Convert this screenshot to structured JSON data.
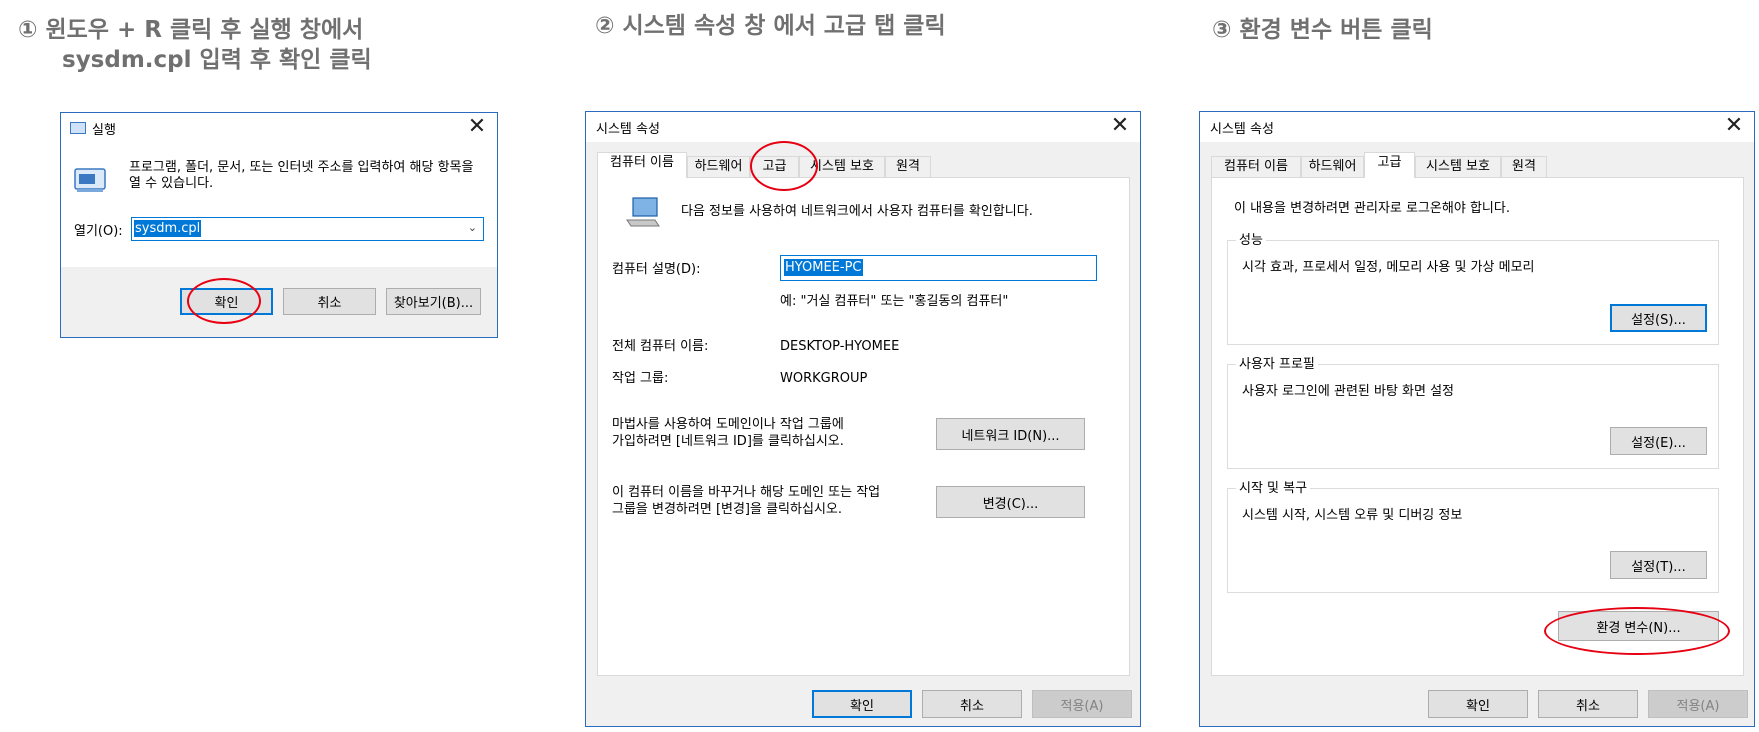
{
  "captions": {
    "step1_line1": "① 윈도우 +  R 클릭 후 실행 창에서",
    "step1_line2": "sysdm.cpl 입력 후 확인 클릭",
    "step2": "② 시스템 속성 창 에서 고급 탭 클릭",
    "step3": "③ 환경 변수 버튼 클릭"
  },
  "run_dialog": {
    "title": "실행",
    "description": "프로그램, 폴더, 문서, 또는 인터넷 주소를 입력하여 해당 항목을 열 수 있습니다.",
    "open_label": "열기(O):",
    "open_value": "sysdm.cpl",
    "ok": "확인",
    "cancel": "취소",
    "browse": "찾아보기(B)..."
  },
  "sysprops_computer_name": {
    "title": "시스템 속성",
    "tabs": [
      "컴퓨터 이름",
      "하드웨어",
      "고급",
      "시스템 보호",
      "원격"
    ],
    "intro": "다음 정보를 사용하여 네트워크에서 사용자 컴퓨터를 확인합니다.",
    "desc_label": "컴퓨터 설명(D):",
    "desc_value": "HYOMEE-PC",
    "example": "예: \"거실 컴퓨터\" 또는 \"홍길동의 컴퓨터\"",
    "fullname_label": "전체 컴퓨터 이름:",
    "fullname_value": "DESKTOP-HYOMEE",
    "workgroup_label": "작업 그룹:",
    "workgroup_value": "WORKGROUP",
    "network_text_1": "마법사를 사용하여 도메인이나 작업 그룹에",
    "network_text_2": "가입하려면 [네트워크 ID]를 클릭하십시오.",
    "network_button": "네트워크 ID(N)...",
    "change_text_1": "이 컴퓨터 이름을 바꾸거나 해당 도메인 또는 작업",
    "change_text_2": "그룹을 변경하려면 [변경]을 클릭하십시오.",
    "change_button": "변경(C)...",
    "ok": "확인",
    "cancel": "취소",
    "apply": "적용(A)"
  },
  "sysprops_advanced": {
    "title": "시스템 속성",
    "tabs": [
      "컴퓨터 이름",
      "하드웨어",
      "고급",
      "시스템 보호",
      "원격"
    ],
    "admin_note": "이 내용을 변경하려면 관리자로 로그온해야 합니다.",
    "perf_label": "성능",
    "perf_text": "시각 효과, 프로세서 일정, 메모리 사용 및 가상 메모리",
    "perf_button": "설정(S)...",
    "profile_label": "사용자 프로필",
    "profile_text": "사용자 로그인에 관련된 바탕 화면 설정",
    "profile_button": "설정(E)...",
    "startup_label": "시작 및 복구",
    "startup_text": "시스템 시작, 시스템 오류 및 디버깅 정보",
    "startup_button": "설정(T)...",
    "env_button": "환경 변수(N)...",
    "ok": "확인",
    "cancel": "취소",
    "apply": "적용(A)"
  },
  "colors": {
    "highlight_ellipse": "#e60012",
    "selection": "#0078d7",
    "caption": "#707070"
  }
}
